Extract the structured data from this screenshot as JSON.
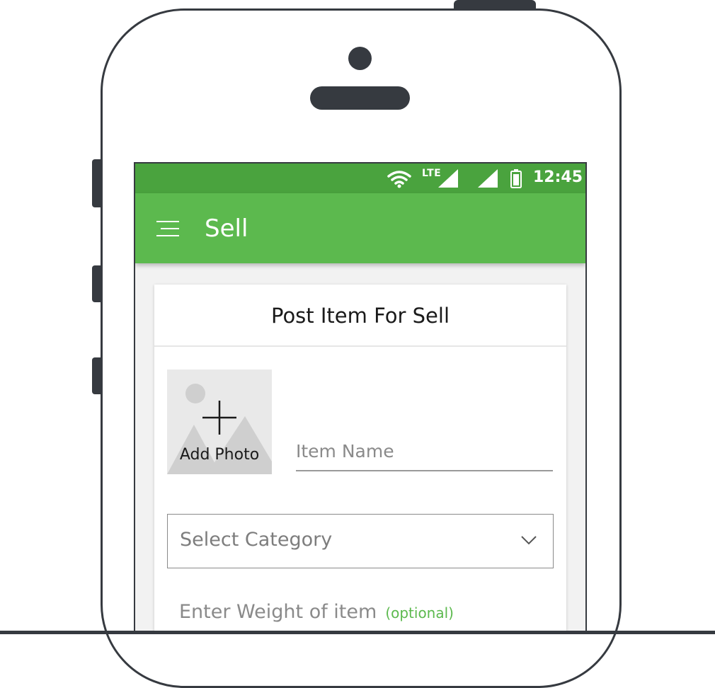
{
  "status_bar": {
    "network_label": "LTE",
    "time": "12:45",
    "icons": [
      "wifi-icon",
      "signal-icon",
      "signal-icon",
      "battery-icon"
    ]
  },
  "app_bar": {
    "title": "Sell",
    "menu_icon": "hamburger-menu-icon"
  },
  "form": {
    "heading": "Post Item For Sell",
    "add_photo_label": "Add Photo",
    "item_name_placeholder": "Item Name",
    "item_name_value": "",
    "category_placeholder": "Select Category",
    "weight_placeholder": "Enter Weight of item",
    "weight_optional": "(optional)"
  },
  "colors": {
    "status_bar": "#4aa33e",
    "app_bar": "#5cb94e",
    "accent": "#5cb94e",
    "frame": "#363a40"
  }
}
